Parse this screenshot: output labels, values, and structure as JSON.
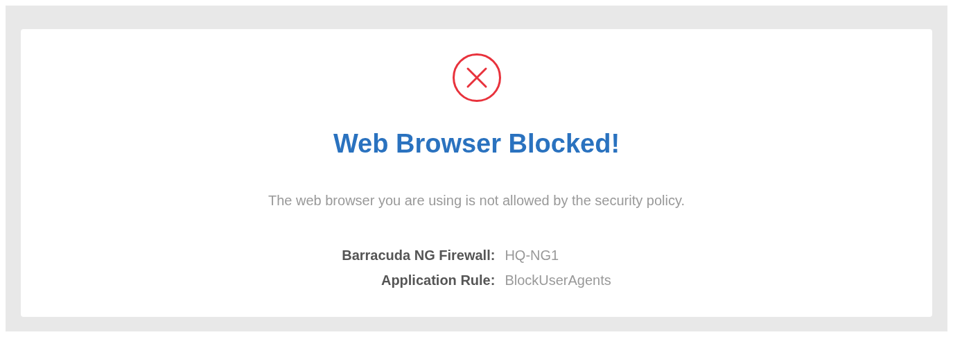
{
  "title": "Web Browser Blocked!",
  "message": "The web browser you are using is not allowed by the security policy.",
  "details": [
    {
      "label": "Barracuda NG Firewall:",
      "value": "HQ-NG1"
    },
    {
      "label": "Application Rule:",
      "value": "BlockUserAgents"
    }
  ]
}
